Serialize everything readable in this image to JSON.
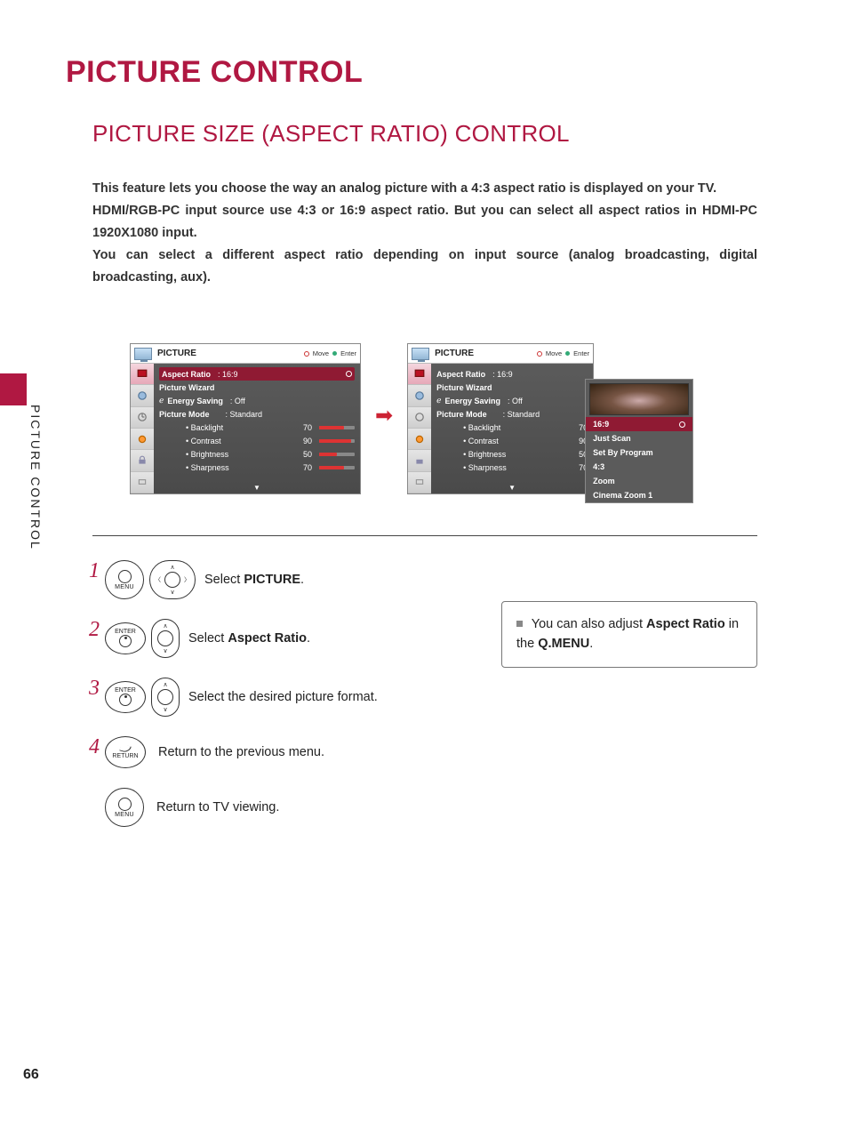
{
  "page_number": "66",
  "side_label": "PICTURE CONTROL",
  "h1": "PICTURE CONTROL",
  "h2": "PICTURE SIZE (ASPECT RATIO) CONTROL",
  "intro": [
    "This feature lets you choose the way an analog picture with a 4:3 aspect ratio is displayed on your TV.",
    "HDMI/RGB-PC input source use 4:3 or 16:9 aspect ratio. But you can select all aspect ratios in HDMI-PC 1920X1080 input.",
    "You can select a different aspect ratio depending on input source (analog broadcasting, digital broadcasting, aux)."
  ],
  "osd": {
    "title": "PICTURE",
    "hint_move": "Move",
    "hint_enter": "Enter",
    "items": {
      "aspect_ratio_label": "Aspect Ratio",
      "aspect_ratio_value": ": 16:9",
      "picture_wizard": "Picture Wizard",
      "energy_saving_label": "Energy Saving",
      "energy_saving_value": ": Off",
      "picture_mode_label": "Picture Mode",
      "picture_mode_value": ": Standard",
      "backlight_label": "• Backlight",
      "backlight_value": "70",
      "contrast_label": "• Contrast",
      "contrast_value": "90",
      "brightness_label": "• Brightness",
      "brightness_value": "50",
      "sharpness_label": "• Sharpness",
      "sharpness_value": "70"
    },
    "popup_options": [
      "16:9",
      "Just Scan",
      "Set By Program",
      "4:3",
      "Zoom",
      "Cinema Zoom 1"
    ]
  },
  "steps": {
    "s1_pre": "Select ",
    "s1_b": "PICTURE",
    "s1_post": ".",
    "s2_pre": "Select ",
    "s2_b": "Aspect Ratio",
    "s2_post": ".",
    "s3": "Select the desired picture format.",
    "s4": "Return to the previous menu.",
    "s5": "Return to TV viewing.",
    "btn_menu": "MENU",
    "btn_enter": "ENTER",
    "btn_return": "RETURN"
  },
  "note": {
    "pre": "You can also adjust ",
    "b1": "Aspect Ratio",
    "mid": " in the ",
    "b2": "Q.MENU",
    "post": "."
  }
}
